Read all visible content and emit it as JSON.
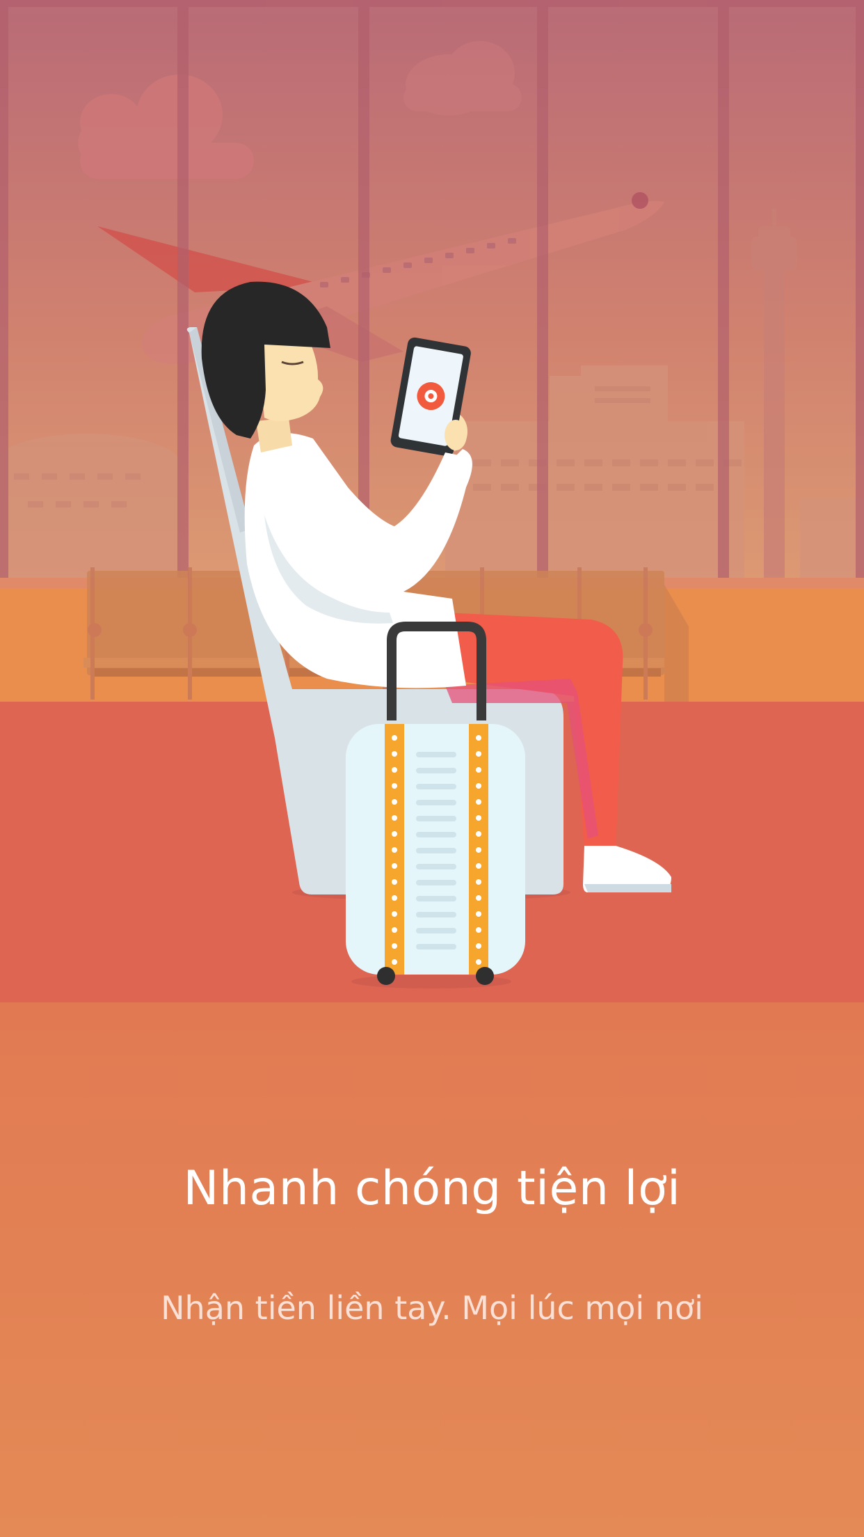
{
  "onboarding": {
    "title": "Nhanh chóng tiện lợi",
    "subtitle": "Nhận tiền liền tay. Mọi lúc mọi nơi"
  },
  "illustration": {
    "subject": "traveler reading tablet in airport lounge",
    "icons": [
      "cloud-icon",
      "airplane-icon",
      "control-tower-icon",
      "tablet-icon",
      "suitcase-icon",
      "app-logo-icon"
    ]
  },
  "colors": {
    "background_top": "#dd6253",
    "background_bottom": "#e48a56",
    "title": "#ffffff",
    "subtitle": "#fbe0d6",
    "accent": "#f15a3c"
  }
}
